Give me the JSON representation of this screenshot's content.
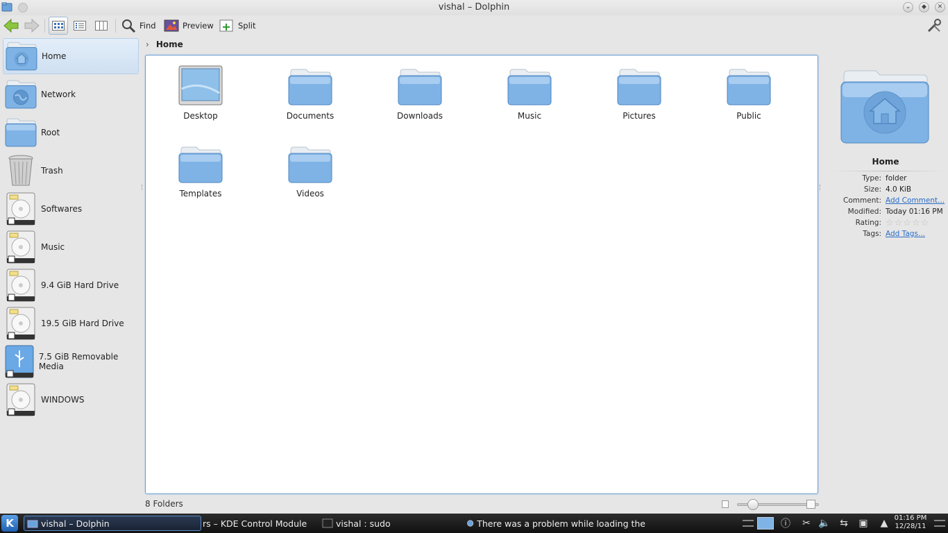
{
  "window": {
    "title": "vishal – Dolphin"
  },
  "toolbar": {
    "find_label": "Find",
    "preview_label": "Preview",
    "split_label": "Split"
  },
  "places": [
    {
      "label": "Home",
      "icon": "home-folder-icon",
      "active": true
    },
    {
      "label": "Network",
      "icon": "network-folder-icon"
    },
    {
      "label": "Root",
      "icon": "folder-icon"
    },
    {
      "label": "Trash",
      "icon": "trash-icon"
    },
    {
      "label": "Softwares",
      "icon": "hard-drive-icon"
    },
    {
      "label": "Music",
      "icon": "hard-drive-icon"
    },
    {
      "label": "9.4 GiB Hard Drive",
      "icon": "hard-drive-icon"
    },
    {
      "label": "19.5 GiB Hard Drive",
      "icon": "hard-drive-icon"
    },
    {
      "label": "7.5 GiB Removable Media",
      "icon": "usb-drive-icon"
    },
    {
      "label": "WINDOWS",
      "icon": "hard-drive-icon"
    }
  ],
  "breadcrumb": {
    "current": "Home"
  },
  "files": [
    {
      "name": "Desktop",
      "icon": "desktop-icon"
    },
    {
      "name": "Documents",
      "icon": "folder-icon"
    },
    {
      "name": "Downloads",
      "icon": "folder-icon"
    },
    {
      "name": "Music",
      "icon": "folder-icon"
    },
    {
      "name": "Pictures",
      "icon": "folder-icon"
    },
    {
      "name": "Public",
      "icon": "folder-icon"
    },
    {
      "name": "Templates",
      "icon": "folder-icon"
    },
    {
      "name": "Videos",
      "icon": "folder-icon"
    }
  ],
  "status": {
    "text": "8 Folders"
  },
  "info": {
    "name": "Home",
    "type_key": "Type:",
    "type_val": "folder",
    "size_key": "Size:",
    "size_val": "4.0 KiB",
    "comment_key": "Comment:",
    "comment_val": "Add Comment...",
    "modified_key": "Modified:",
    "modified_val": "Today 01:16 PM",
    "rating_key": "Rating:",
    "rating_stars": 0,
    "rating_max": 5,
    "tags_key": "Tags:",
    "tags_val": "Add Tags..."
  },
  "taskbar": {
    "kmenu_label": "K",
    "tasks": [
      "vishal – Dolphin",
      "rs – KDE Control Module",
      "vishal : sudo",
      "There was a problem while loading the"
    ],
    "clock_time": "01:16 PM",
    "clock_date": "12/28/11"
  },
  "colors": {
    "accent": "#6f9fd4",
    "folder_blue": "#7fb3e6",
    "link": "#2b6cc4"
  }
}
